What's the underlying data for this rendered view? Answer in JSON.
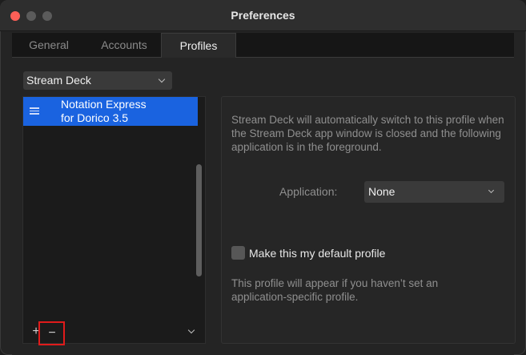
{
  "window": {
    "title": "Preferences"
  },
  "tabs": [
    {
      "label": "General",
      "selected": false
    },
    {
      "label": "Accounts",
      "selected": false
    },
    {
      "label": "Profiles",
      "selected": true
    }
  ],
  "profile_selector": {
    "value": "Stream Deck"
  },
  "profile_list": {
    "items": [
      {
        "line1": "Notation Express",
        "line2": "for Dorico 3.5",
        "selected": true
      }
    ],
    "add_label": "+",
    "remove_label": "−"
  },
  "detail": {
    "description": "Stream Deck will automatically switch to this profile when the Stream Deck app window is closed and the following application is in the foreground.",
    "application_label": "Application:",
    "application_value": "None",
    "default_checkbox_label": "Make this my default profile",
    "default_checked": false,
    "hint": "This profile will appear if you haven’t set an application-specific profile."
  },
  "colors": {
    "accent": "#1a63e0",
    "highlight_box": "#e01b1b",
    "close_button": "#ff5f57"
  }
}
